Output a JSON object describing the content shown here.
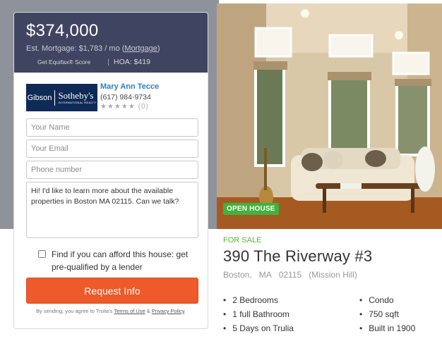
{
  "listing": {
    "price": "$374,000",
    "est_prefix": "Est. Mortgage: $1,783 / mo (",
    "mortgage_link": "Mortgage",
    "est_suffix": ")",
    "equifax": "Get Equifax® Score",
    "hoa": "HOA: $419"
  },
  "agent": {
    "logo_left": "Gibson",
    "logo_right": "Sotheby's",
    "logo_sub": "INTERNATIONAL REALTY",
    "name": "Mary Ann Tecce",
    "phone": "(617) 984-9734",
    "rating_stars": "★★★★★",
    "rating_count": "(0)"
  },
  "form": {
    "name_placeholder": "Your Name",
    "email_placeholder": "Your Email",
    "phone_placeholder": "Phone number",
    "message": "Hi! I'd like to learn more about the available properties in Boston MA 02115. Can we talk?",
    "afford_label": "Find if you can afford this house: get pre-qualified by a lender",
    "submit_label": "Request Info",
    "fine_prefix": "By sending, you agree to Trulia's ",
    "terms_link": "Terms of Use",
    "fine_and": " & ",
    "privacy_link": "Privacy Policy",
    "fine_suffix": "."
  },
  "badge": {
    "open_house": "OPEN HOUSE"
  },
  "property": {
    "status": "FOR SALE",
    "address": "390 The Riverway #3",
    "city": "Boston,",
    "state": "MA",
    "zip": "02115",
    "neighborhood": "(Mission Hill)",
    "facts": [
      "2 Bedrooms",
      "Condo",
      "1 full Bathroom",
      "750 sqft",
      "5 Days on Trulia",
      "Built in 1900"
    ]
  },
  "colors": {
    "header": "#3f4561",
    "accent": "#ee5a2a",
    "status_green": "#5bb535",
    "link": "#2a80c4"
  }
}
